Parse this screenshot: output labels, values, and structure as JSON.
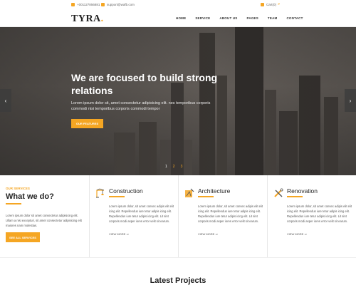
{
  "topbar": {
    "phone": "+001127856881",
    "email": "support@wafb.com",
    "cart": "Cart(0)"
  },
  "header": {
    "logo": "TYRA",
    "logo_dot": ".",
    "nav": [
      "HOME",
      "SERVICE",
      "ABOUT US",
      "PAGES",
      "TEAM",
      "CONTACT"
    ]
  },
  "hero": {
    "title": "We are focused to build strong relations",
    "description": "Lorem ipsum dolor sit, amet consectetur adipisicing elit. nes temporibus corporis commodi nisi temporibus corporis commodi tempor",
    "button": "OUR FEATURES",
    "slides": [
      "1",
      "2",
      "3"
    ],
    "active_slide": 0
  },
  "services": {
    "label": "OUR SERVICES",
    "title": "What we do?",
    "text": "Lorem ipsum dolor sit amet consectetur adipisicing elit. Ullam a nisi excepturi, sit amet consectetur adipisicing elit maiores nam molestias.",
    "button": "SEE ALL SERVICES",
    "cards": [
      {
        "title": "Construction",
        "icon": "crane-icon",
        "text": "Lorem ipsum dolor, sit amet consec adipis elit elit icing elit. Repellendus iure tetur adipis icing elit. Repellendus iure tetur adipis icing elit. Lit sint corporis modi asper iores error velit sit earum.",
        "more": "VIEW MORE ⇒"
      },
      {
        "title": "Architecture",
        "icon": "blueprint-icon",
        "text": "Lorem ipsum dolor, sit amet consec adipis elit elit icing elit. Repellendus iure tetur adipis icing elit. Repellendus iure tetur adipis icing elit. Lit sint corporis modi asper iores error velit sit earum.",
        "more": "VIEW MORE ⇒"
      },
      {
        "title": "Renovation",
        "icon": "tools-icon",
        "text": "Lorem ipsum dolor, sit amet consec adipis elit elit icing elit. Repellendus iure tetur adipis icing elit. Repellendus iure tetur adipis icing elit. Lit sint corporis modi asper iores error velit sit earum.",
        "more": "VIEW MORE ⇒"
      }
    ]
  },
  "latest": {
    "title": "Latest Projects"
  },
  "colors": {
    "accent": "#f5a623",
    "dark": "#222222"
  }
}
